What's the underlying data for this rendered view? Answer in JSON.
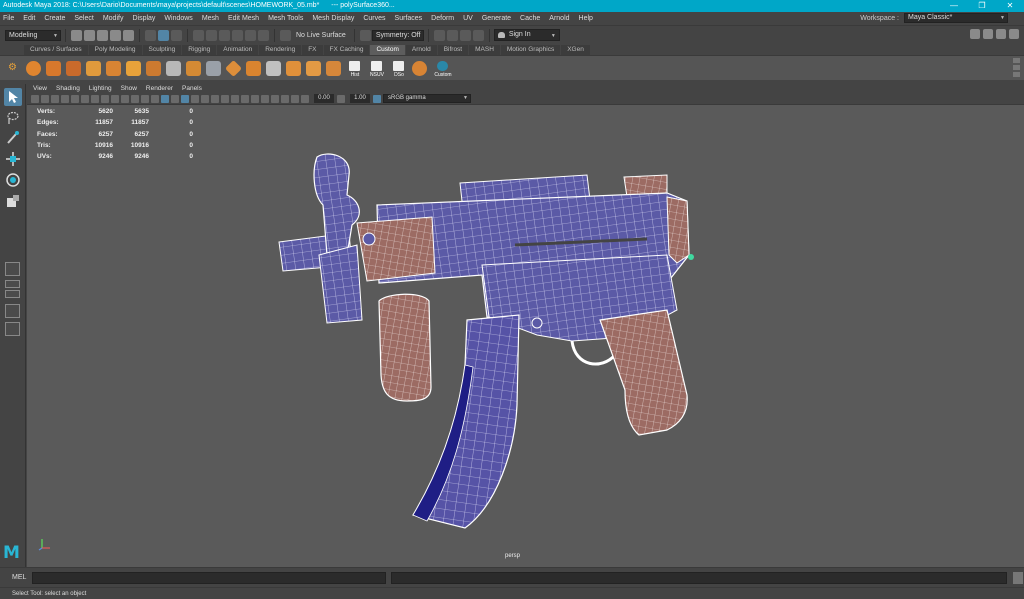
{
  "window": {
    "title": "Autodesk Maya 2018: C:\\Users\\Dario\\Documents\\maya\\projects\\default\\scenes\\HOMEWORK_05.mb*",
    "selection": "---   polySurface360...",
    "controls": [
      "—",
      "❐",
      "✕"
    ]
  },
  "menu": [
    "File",
    "Edit",
    "Create",
    "Select",
    "Modify",
    "Display",
    "Windows",
    "Mesh",
    "Edit Mesh",
    "Mesh Tools",
    "Mesh Display",
    "Curves",
    "Surfaces",
    "Deform",
    "UV",
    "Generate",
    "Cache",
    "Arnold",
    "Help"
  ],
  "workspace": {
    "label": "Workspace :",
    "value": "Maya Classic*"
  },
  "statusline": {
    "mode": "Modeling",
    "live_surface": "No Live Surface",
    "symmetry": "Symmetry: Off",
    "sign_in": "Sign In"
  },
  "shelf_tabs": [
    "Curves / Surfaces",
    "Poly Modeling",
    "Sculpting",
    "Rigging",
    "Animation",
    "Rendering",
    "FX",
    "FX Caching",
    "Custom",
    "Arnold",
    "Bifrost",
    "MASH",
    "Motion Graphics",
    "XGen"
  ],
  "active_shelf_tab": "Custom",
  "shelf_labels": {
    "hist": "Hist",
    "nsuv": "NSUV",
    "dso": "DSo",
    "custom": "Custom"
  },
  "viewport_menu": [
    "View",
    "Shading",
    "Lighting",
    "Show",
    "Renderer",
    "Panels"
  ],
  "viewport_toolbar": {
    "exposure": "0.00",
    "gamma": "1.00",
    "color_space": "sRGB gamma"
  },
  "hud": [
    {
      "label": "Verts:",
      "v1": "5620",
      "v2": "5635",
      "v3": "0"
    },
    {
      "label": "Edges:",
      "v1": "11857",
      "v2": "11857",
      "v3": "0"
    },
    {
      "label": "Faces:",
      "v1": "6257",
      "v2": "6257",
      "v3": "0"
    },
    {
      "label": "Tris:",
      "v1": "10916",
      "v2": "10916",
      "v3": "0"
    },
    {
      "label": "UVs:",
      "v1": "9246",
      "v2": "9246",
      "v3": "0"
    }
  ],
  "camera": "persp",
  "cmd": {
    "label": "MEL"
  },
  "help_line": "Select Tool: select an object",
  "colors": {
    "accent": "#00a7c8",
    "selection": "#5285a6",
    "wire": "#ffffff",
    "body": "#5a58a8",
    "grip": "#9a6a62",
    "mag": "#20208a"
  }
}
